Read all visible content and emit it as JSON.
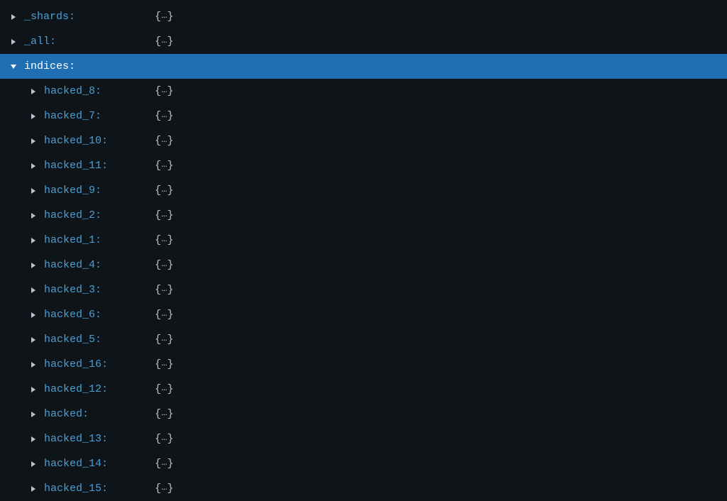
{
  "nodes": [
    {
      "key": "_shards:",
      "level": 0,
      "expanded": false,
      "selected": false,
      "hasValue": true
    },
    {
      "key": "_all:",
      "level": 0,
      "expanded": false,
      "selected": false,
      "hasValue": true
    },
    {
      "key": "indices:",
      "level": 0,
      "expanded": true,
      "selected": true,
      "hasValue": false
    },
    {
      "key": "hacked_8:",
      "level": 1,
      "expanded": false,
      "selected": false,
      "hasValue": true
    },
    {
      "key": "hacked_7:",
      "level": 1,
      "expanded": false,
      "selected": false,
      "hasValue": true
    },
    {
      "key": "hacked_10:",
      "level": 1,
      "expanded": false,
      "selected": false,
      "hasValue": true
    },
    {
      "key": "hacked_11:",
      "level": 1,
      "expanded": false,
      "selected": false,
      "hasValue": true
    },
    {
      "key": "hacked_9:",
      "level": 1,
      "expanded": false,
      "selected": false,
      "hasValue": true
    },
    {
      "key": "hacked_2:",
      "level": 1,
      "expanded": false,
      "selected": false,
      "hasValue": true
    },
    {
      "key": "hacked_1:",
      "level": 1,
      "expanded": false,
      "selected": false,
      "hasValue": true
    },
    {
      "key": "hacked_4:",
      "level": 1,
      "expanded": false,
      "selected": false,
      "hasValue": true
    },
    {
      "key": "hacked_3:",
      "level": 1,
      "expanded": false,
      "selected": false,
      "hasValue": true
    },
    {
      "key": "hacked_6:",
      "level": 1,
      "expanded": false,
      "selected": false,
      "hasValue": true
    },
    {
      "key": "hacked_5:",
      "level": 1,
      "expanded": false,
      "selected": false,
      "hasValue": true
    },
    {
      "key": "hacked_16:",
      "level": 1,
      "expanded": false,
      "selected": false,
      "hasValue": true
    },
    {
      "key": "hacked_12:",
      "level": 1,
      "expanded": false,
      "selected": false,
      "hasValue": true
    },
    {
      "key": "hacked:",
      "level": 1,
      "expanded": false,
      "selected": false,
      "hasValue": true
    },
    {
      "key": "hacked_13:",
      "level": 1,
      "expanded": false,
      "selected": false,
      "hasValue": true
    },
    {
      "key": "hacked_14:",
      "level": 1,
      "expanded": false,
      "selected": false,
      "hasValue": true
    },
    {
      "key": "hacked_15:",
      "level": 1,
      "expanded": false,
      "selected": false,
      "hasValue": true
    }
  ],
  "placeholder": {
    "open": "{",
    "dots": "…",
    "close": "}"
  }
}
